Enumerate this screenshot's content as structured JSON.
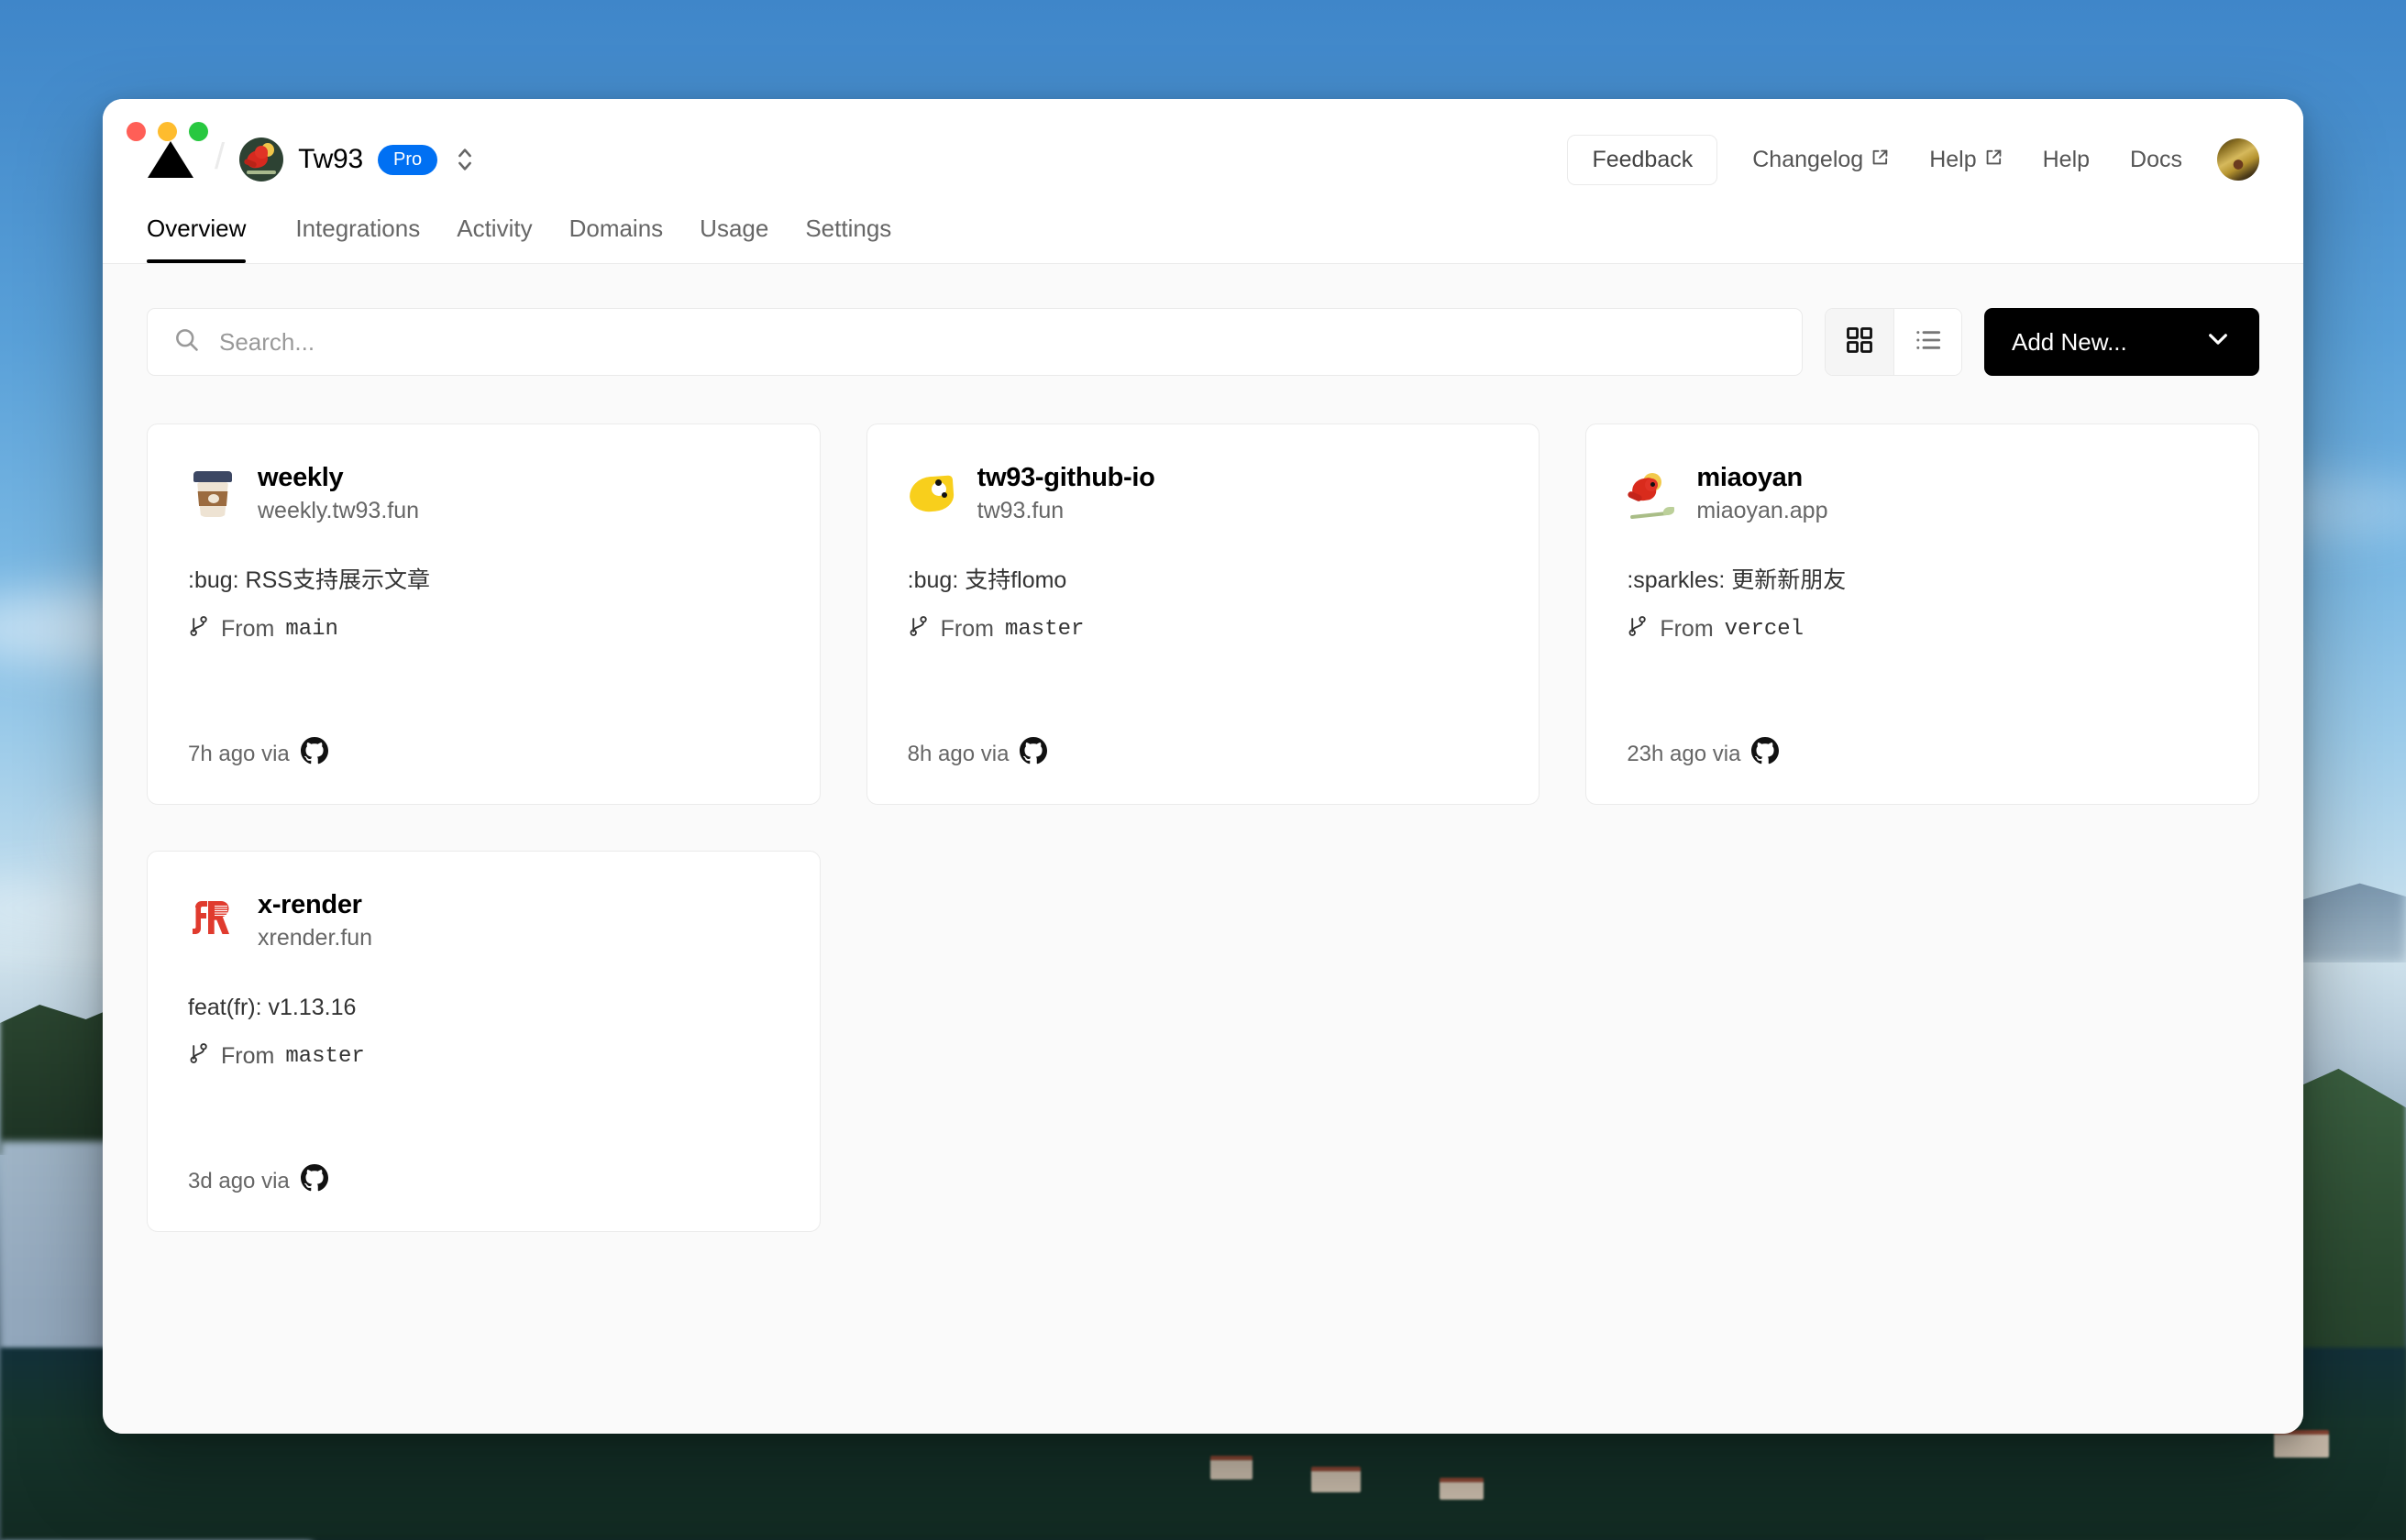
{
  "window": {
    "traffic_lights": [
      "close",
      "minimize",
      "maximize"
    ]
  },
  "header": {
    "logo_icon": "vercel-triangle-logo",
    "separator": "/",
    "team": {
      "avatar_icon": "cardinal-bird-avatar",
      "name": "Tw93",
      "plan_badge": "Pro",
      "switcher_icon": "chevron-up-down-icon"
    },
    "actions": {
      "feedback_label": "Feedback",
      "links": [
        {
          "label": "Changelog",
          "external": true,
          "icon": "external-link-icon"
        },
        {
          "label": "Help",
          "external": true,
          "icon": "external-link-icon"
        },
        {
          "label": "Help",
          "external": false,
          "icon": ""
        },
        {
          "label": "Docs",
          "external": false,
          "icon": ""
        }
      ],
      "user_avatar_icon": "user-avatar"
    }
  },
  "tabs": [
    {
      "label": "Overview",
      "active": true
    },
    {
      "label": "Integrations",
      "active": false
    },
    {
      "label": "Activity",
      "active": false
    },
    {
      "label": "Domains",
      "active": false
    },
    {
      "label": "Usage",
      "active": false
    },
    {
      "label": "Settings",
      "active": false
    }
  ],
  "toolbar": {
    "search": {
      "icon": "search-icon",
      "placeholder": "Search...",
      "value": ""
    },
    "view_modes": [
      {
        "name": "grid",
        "icon": "grid-view-icon",
        "active": true
      },
      {
        "name": "list",
        "icon": "list-view-icon",
        "active": false
      }
    ],
    "add_new": {
      "label": "Add New...",
      "icon": "chevron-down-icon"
    }
  },
  "projects": [
    {
      "logo_icon": "coffee-cup-icon",
      "name": "weekly",
      "domain": "weekly.tw93.fun",
      "commit": ":bug: RSS支持展示文章",
      "branch_icon": "git-branch-icon",
      "branch_prefix": "From",
      "branch": "main",
      "time": "7h ago via",
      "source_icon": "github-icon"
    },
    {
      "logo_icon": "yellow-bird-icon",
      "name": "tw93-github-io",
      "domain": "tw93.fun",
      "commit": ":bug: 支持flomo",
      "branch_icon": "git-branch-icon",
      "branch_prefix": "From",
      "branch": "master",
      "time": "8h ago via",
      "source_icon": "github-icon"
    },
    {
      "logo_icon": "cardinal-bird-icon",
      "name": "miaoyan",
      "domain": "miaoyan.app",
      "commit": ":sparkles: 更新新朋友",
      "branch_icon": "git-branch-icon",
      "branch_prefix": "From",
      "branch": "vercel",
      "time": "23h ago via",
      "source_icon": "github-icon"
    },
    {
      "logo_icon": "xrender-logo-icon",
      "name": "x-render",
      "domain": "xrender.fun",
      "commit": "feat(fr): v1.13.16",
      "branch_icon": "git-branch-icon",
      "branch_prefix": "From",
      "branch": "master",
      "time": "3d ago via",
      "source_icon": "github-icon"
    }
  ],
  "colors": {
    "accent_blue": "#0070f3",
    "button_black": "#000000",
    "card_border": "#ebebeb",
    "main_bg": "#fafafa",
    "xrender_red": "#e03b2e",
    "bird_yellow": "#f8cf1c"
  }
}
